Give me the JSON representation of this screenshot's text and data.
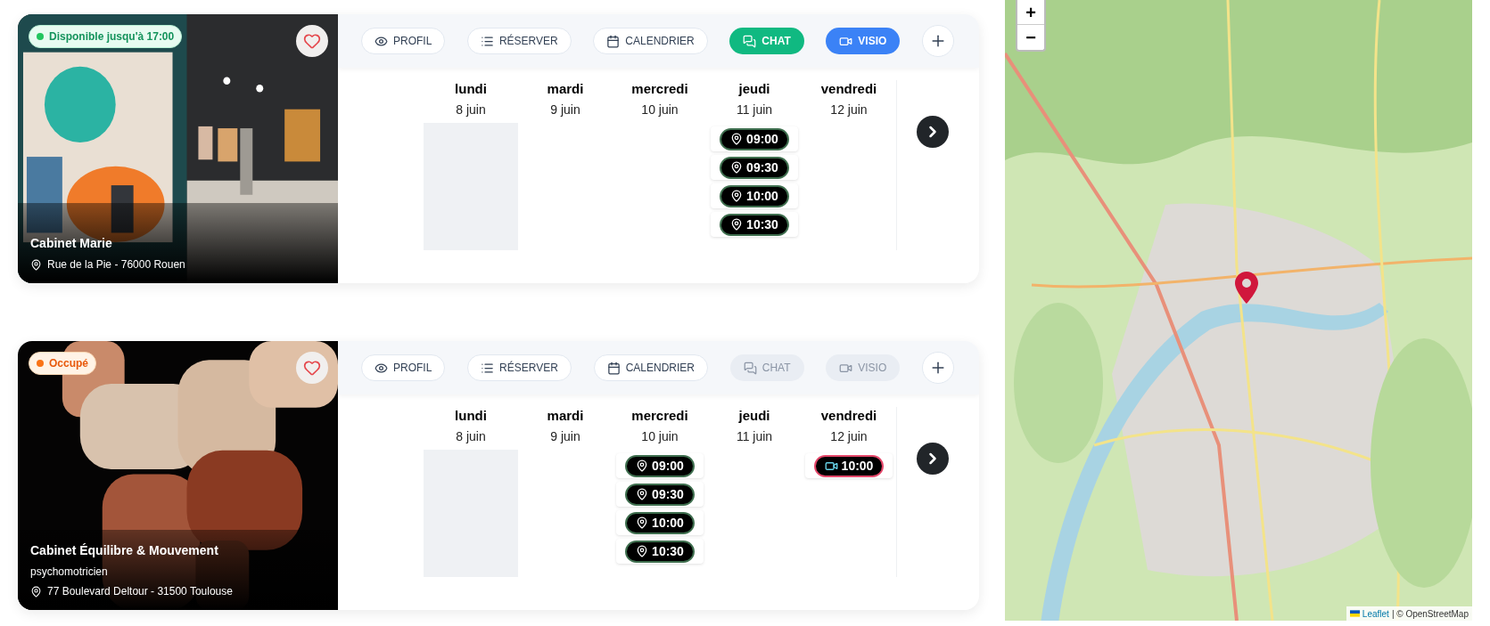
{
  "cards": [
    {
      "status": {
        "label": "Disponible jusqu'à 17:00",
        "kind": "available",
        "color": "#22c55e"
      },
      "name": "Cabinet Marie",
      "address": "Rue de la Pie - 76000 Rouen",
      "actions": [
        {
          "label": "PROFIL",
          "kind": "profile",
          "disabled": false
        },
        {
          "label": "RÉSERVER",
          "kind": "book",
          "disabled": false
        },
        {
          "label": "CALENDRIER",
          "kind": "calendar",
          "disabled": false
        },
        {
          "label": "CHAT",
          "kind": "chat",
          "disabled": false
        },
        {
          "label": "VISIO",
          "kind": "video",
          "disabled": false
        }
      ],
      "days": [
        {
          "day": "lundi",
          "date": "8 juin",
          "unavailable": true
        },
        {
          "day": "mardi",
          "date": "9 juin",
          "unavailable": false
        },
        {
          "day": "mercredi",
          "date": "10 juin",
          "unavailable": false
        },
        {
          "day": "jeudi",
          "date": "11 juin",
          "unavailable": false,
          "slots": [
            {
              "time": "09:00",
              "kind": "location"
            },
            {
              "time": "09:30",
              "kind": "location"
            },
            {
              "time": "10:00",
              "kind": "location"
            },
            {
              "time": "10:30",
              "kind": "location"
            }
          ]
        },
        {
          "day": "vendredi",
          "date": "12 juin",
          "unavailable": false
        }
      ]
    },
    {
      "status": {
        "label": "Occupé",
        "kind": "busy",
        "color": "#f97316"
      },
      "name": "Cabinet Équilibre & Mouvement",
      "subtitle": "psychomotricien",
      "address": "77 Boulevard Deltour - 31500 Toulouse",
      "actions": [
        {
          "label": "PROFIL",
          "kind": "profile",
          "disabled": false
        },
        {
          "label": "RÉSERVER",
          "kind": "book",
          "disabled": false
        },
        {
          "label": "CALENDRIER",
          "kind": "calendar",
          "disabled": false
        },
        {
          "label": "CHAT",
          "kind": "chat",
          "disabled": true
        },
        {
          "label": "VISIO",
          "kind": "video",
          "disabled": true
        }
      ],
      "days": [
        {
          "day": "lundi",
          "date": "8 juin",
          "unavailable": true
        },
        {
          "day": "mardi",
          "date": "9 juin",
          "unavailable": false
        },
        {
          "day": "mercredi",
          "date": "10 juin",
          "unavailable": false,
          "slots": [
            {
              "time": "09:00",
              "kind": "location"
            },
            {
              "time": "09:30",
              "kind": "location"
            },
            {
              "time": "10:00",
              "kind": "location"
            },
            {
              "time": "10:30",
              "kind": "location"
            }
          ]
        },
        {
          "day": "jeudi",
          "date": "11 juin",
          "unavailable": false
        },
        {
          "day": "vendredi",
          "date": "12 juin",
          "unavailable": false,
          "slots": [
            {
              "time": "10:00",
              "kind": "video"
            }
          ]
        }
      ]
    }
  ],
  "map": {
    "zoom_in": "+",
    "zoom_out": "−",
    "attribution_link": "Leaflet",
    "attribution_text": "| © OpenStreetMap"
  }
}
